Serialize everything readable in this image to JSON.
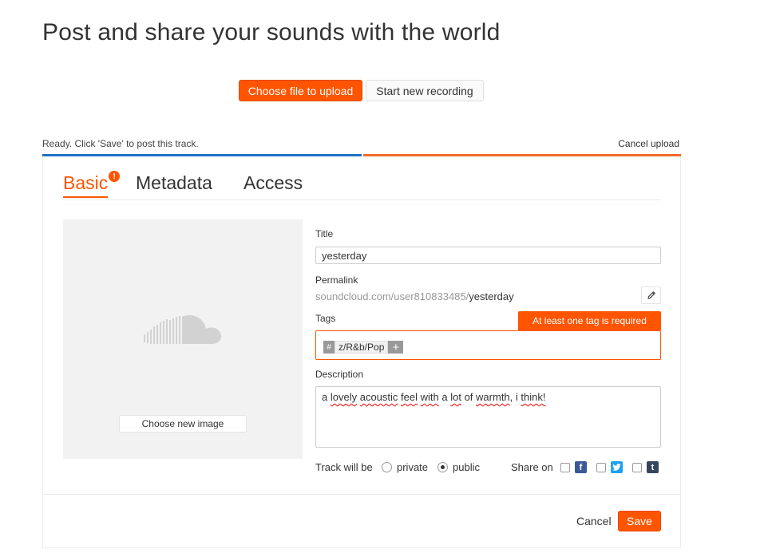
{
  "page": {
    "title": "Post and share your sounds with the world"
  },
  "upload": {
    "choose_file_label": "Choose file to upload",
    "new_recording_label": "Start new recording",
    "status": "Ready. Click 'Save' to post this track.",
    "cancel_label": "Cancel upload",
    "progress_fraction": 0.5
  },
  "tabs": [
    {
      "label": "Basic",
      "active": true,
      "badge": "!"
    },
    {
      "label": "Metadata",
      "active": false
    },
    {
      "label": "Access",
      "active": false
    }
  ],
  "image": {
    "choose_label": "Choose new image",
    "placeholder_icon": "soundcloud-cloud-icon"
  },
  "form": {
    "title_label": "Title",
    "title_value": "yesterday",
    "permalink_label": "Permalink",
    "permalink_base": "soundcloud.com/user810833485/",
    "permalink_slug": "yesterday",
    "tags_label": "Tags",
    "tags_error": "At least one tag is required",
    "tag_hash": "#",
    "tag_value": "z/R&b/Pop",
    "tag_add": "+",
    "description_label": "Description",
    "description_parts": [
      "a ",
      "lovely",
      " ",
      "acoustic",
      " ",
      "feel",
      " ",
      "with",
      " a ",
      "lot",
      " of ",
      "warmth",
      ", i ",
      "think!"
    ]
  },
  "privacy": {
    "label": "Track will be",
    "options": [
      {
        "label": "private",
        "checked": false
      },
      {
        "label": "public",
        "checked": true
      }
    ],
    "share_label": "Share on",
    "networks": [
      {
        "name": "facebook",
        "glyph": "f",
        "color": "#3b5998"
      },
      {
        "name": "twitter",
        "glyph": "t",
        "color": "#1da1f2"
      },
      {
        "name": "tumblr",
        "glyph": "t",
        "color": "#35465c"
      }
    ]
  },
  "footer": {
    "cancel_label": "Cancel",
    "save_label": "Save"
  },
  "colors": {
    "accent": "#ff5500",
    "progress_done": "#1f72c4",
    "progress_rest": "#f26b2a"
  }
}
